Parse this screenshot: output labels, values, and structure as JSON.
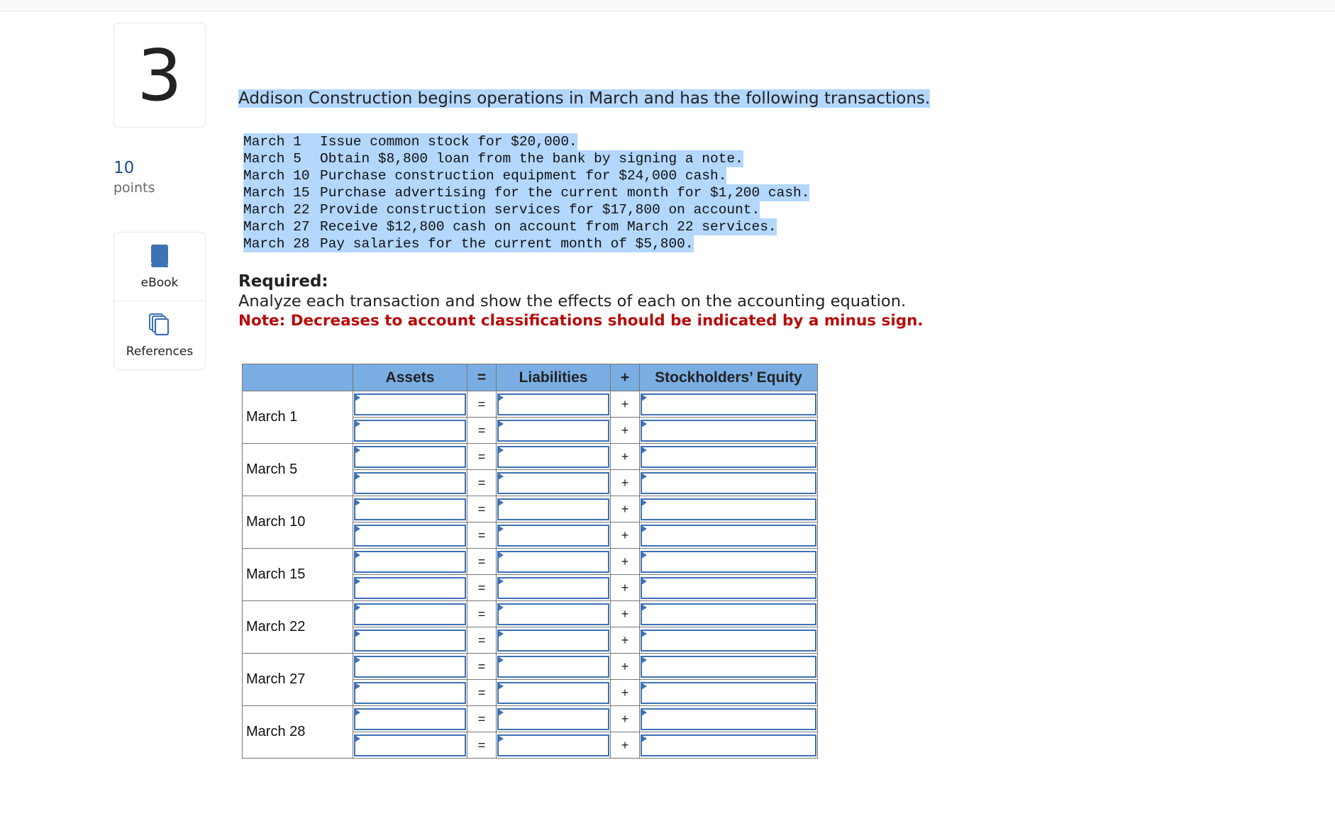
{
  "question": {
    "number": "3",
    "points_value": "10",
    "points_label": "points"
  },
  "tools": [
    {
      "label": "eBook",
      "icon": "book-icon"
    },
    {
      "label": "References",
      "icon": "references-icon"
    }
  ],
  "intro": "Addison Construction begins operations in March and has the following transactions.",
  "transactions": [
    {
      "date": "March 1",
      "text": "Issue common stock for $20,000."
    },
    {
      "date": "March 5",
      "text": "Obtain $8,800 loan from the bank by signing a note."
    },
    {
      "date": "March 10",
      "text": "Purchase construction equipment for $24,000 cash."
    },
    {
      "date": "March 15",
      "text": "Purchase advertising for the current month for $1,200 cash."
    },
    {
      "date": "March 22",
      "text": "Provide construction services for $17,800 on account."
    },
    {
      "date": "March 27",
      "text": "Receive $12,800 cash on account from March 22 services."
    },
    {
      "date": "March 28",
      "text": "Pay salaries for the current month of $5,800."
    }
  ],
  "required": {
    "heading": "Required:",
    "instruction": "Analyze each transaction and show the effects of each on the accounting equation.",
    "note": "Note: Decreases to account classifications should be indicated by a minus sign."
  },
  "table": {
    "headers": {
      "blank": "",
      "assets": "Assets",
      "eq": "=",
      "liabilities": "Liabilities",
      "plus": "+",
      "equity": "Stockholders’ Equity"
    },
    "eq_symbol": "=",
    "plus_symbol": "+",
    "rows": [
      {
        "date": "March 1",
        "lines": [
          {
            "assets": "",
            "liabilities": "",
            "equity": ""
          },
          {
            "assets": "",
            "liabilities": "",
            "equity": ""
          }
        ]
      },
      {
        "date": "March 5",
        "lines": [
          {
            "assets": "",
            "liabilities": "",
            "equity": ""
          },
          {
            "assets": "",
            "liabilities": "",
            "equity": ""
          }
        ]
      },
      {
        "date": "March 10",
        "lines": [
          {
            "assets": "",
            "liabilities": "",
            "equity": ""
          },
          {
            "assets": "",
            "liabilities": "",
            "equity": ""
          }
        ]
      },
      {
        "date": "March 15",
        "lines": [
          {
            "assets": "",
            "liabilities": "",
            "equity": ""
          },
          {
            "assets": "",
            "liabilities": "",
            "equity": ""
          }
        ]
      },
      {
        "date": "March 22",
        "lines": [
          {
            "assets": "",
            "liabilities": "",
            "equity": ""
          },
          {
            "assets": "",
            "liabilities": "",
            "equity": ""
          }
        ]
      },
      {
        "date": "March 27",
        "lines": [
          {
            "assets": "",
            "liabilities": "",
            "equity": ""
          },
          {
            "assets": "",
            "liabilities": "",
            "equity": ""
          }
        ]
      },
      {
        "date": "March 28",
        "lines": [
          {
            "assets": "",
            "liabilities": "",
            "equity": ""
          },
          {
            "assets": "",
            "liabilities": "",
            "equity": ""
          }
        ]
      }
    ]
  },
  "colors": {
    "accent_blue": "#3d72b4",
    "header_blue": "#7aaee3",
    "note_red": "#b80c0c",
    "selection": "#b3d7fd",
    "points_blue": "#1f4e8c"
  }
}
